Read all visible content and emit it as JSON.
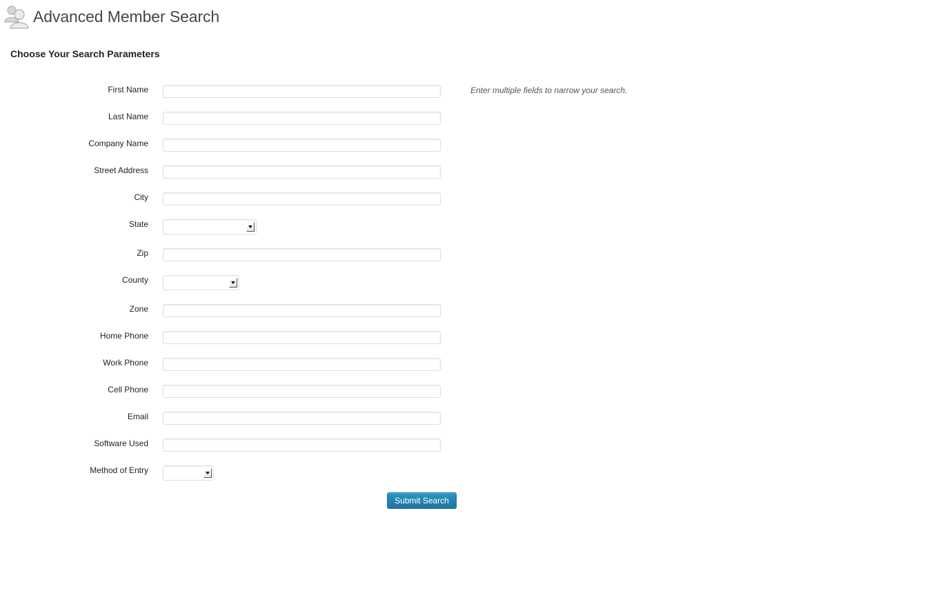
{
  "header": {
    "title": "Advanced Member Search",
    "icon": "users-icon"
  },
  "form": {
    "section_title": "Choose Your Search Parameters",
    "hint": "Enter multiple fields to narrow your search.",
    "fields": {
      "first_name": {
        "label": "First Name",
        "value": ""
      },
      "last_name": {
        "label": "Last Name",
        "value": ""
      },
      "company_name": {
        "label": "Company Name",
        "value": ""
      },
      "street_address": {
        "label": "Street Address",
        "value": ""
      },
      "city": {
        "label": "City",
        "value": ""
      },
      "state": {
        "label": "State",
        "value": ""
      },
      "zip": {
        "label": "Zip",
        "value": ""
      },
      "county": {
        "label": "County",
        "value": ""
      },
      "zone": {
        "label": "Zone",
        "value": ""
      },
      "home_phone": {
        "label": "Home Phone",
        "value": ""
      },
      "work_phone": {
        "label": "Work Phone",
        "value": ""
      },
      "cell_phone": {
        "label": "Cell Phone",
        "value": ""
      },
      "email": {
        "label": "Email",
        "value": ""
      },
      "software_used": {
        "label": "Software Used",
        "value": ""
      },
      "method_of_entry": {
        "label": "Method of Entry",
        "value": ""
      }
    },
    "submit_label": "Submit Search"
  },
  "colors": {
    "accent": "#21759b",
    "title_text": "#464646",
    "hint_text": "#555555",
    "input_border": "#dfdfdf"
  }
}
